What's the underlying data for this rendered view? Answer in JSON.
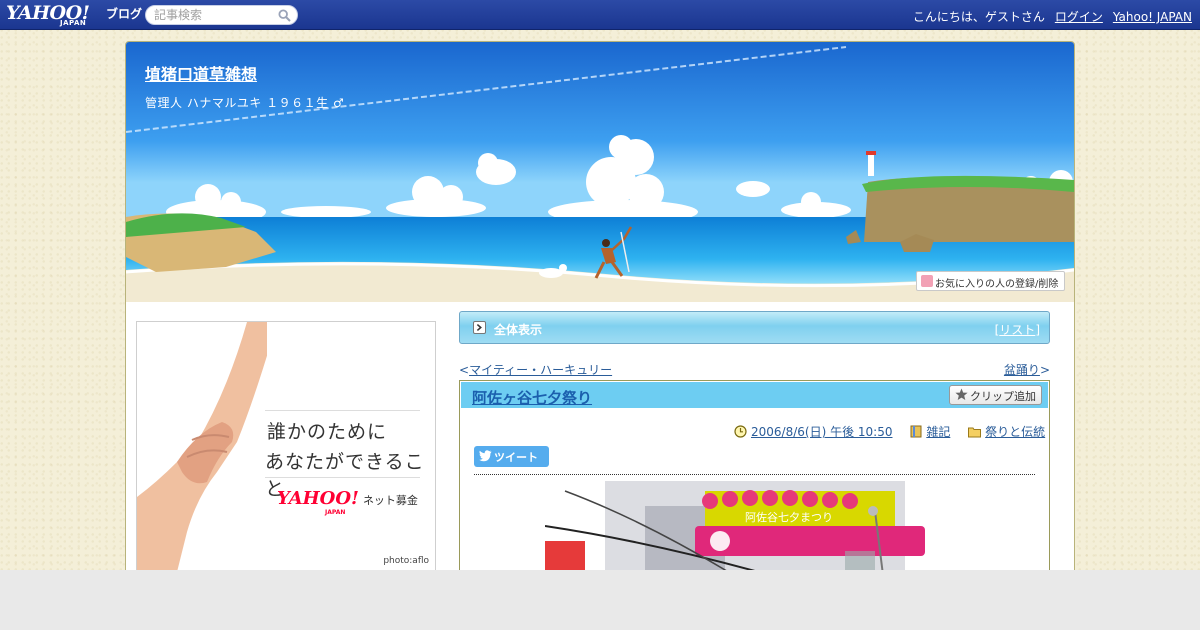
{
  "topbar": {
    "logo_yahoo": "YAHOO!",
    "logo_japan": "JAPAN",
    "logo_blog": "ブログ",
    "search_placeholder": "記事検索",
    "greeting": "こんにちは、ゲストさん",
    "login": "ログイン",
    "yahoo_japan": "Yahoo! JAPAN"
  },
  "header": {
    "title": "埴猪口道草雑想",
    "subtitle": "管理人 ハナマルユキ １９６１生 ♂",
    "fav_button": "お気に入りの人の登録/削除"
  },
  "ad": {
    "line1": "誰かのために",
    "line2": "あなたができること",
    "logo_yahoo": "YAHOO!",
    "logo_japan": "JAPAN",
    "logo_text": "ネット募金",
    "credit": "photo:aflo"
  },
  "nav": {
    "all_label": "全体表示",
    "list_open": "[",
    "list_label": "リスト",
    "list_close": "]"
  },
  "prevnext": {
    "prev_arrow": "<",
    "prev_label": "マイティー・ハーキュリー",
    "next_label": "盆踊り",
    "next_arrow": ">"
  },
  "article": {
    "title": "阿佐ヶ谷七夕祭り",
    "clip_button": "クリップ追加",
    "date": "2006/8/6(日) 午後 10:50",
    "category1": "雑記",
    "category2": "祭りと伝統",
    "tweet": "ツイート"
  },
  "photo": {
    "sign_text": "阿佐谷七夕まつり"
  },
  "colors": {
    "topbar": "#1b3690",
    "sky": "#1e78d8",
    "title_bar": "#6dcdf2",
    "link": "#2a5c99"
  }
}
